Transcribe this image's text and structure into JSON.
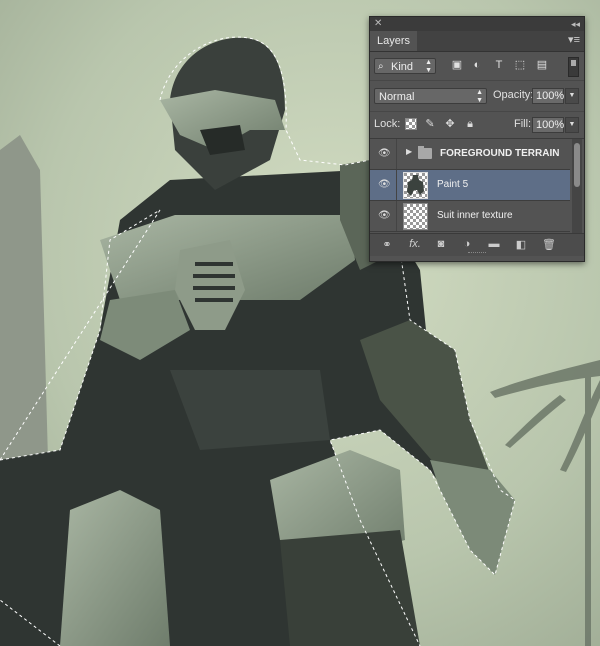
{
  "panel": {
    "close_glyph": "✕",
    "collapse_glyph": "◂◂",
    "tab_label": "Layers",
    "menu_glyph": "▾≡",
    "filter": {
      "kind_label": "Kind",
      "icons": [
        "image-filter-icon",
        "adjustment-filter-icon",
        "type-filter-icon",
        "shape-filter-icon",
        "smart-object-filter-icon"
      ]
    },
    "blend_mode": "Normal",
    "opacity_label": "Opacity:",
    "opacity_value": "100%",
    "lock_label": "Lock:",
    "fill_label": "Fill:",
    "fill_value": "100%",
    "layers": [
      {
        "name": "FOREGROUND TERRAIN",
        "type": "group",
        "visible": true,
        "selected": false
      },
      {
        "name": "Paint 5",
        "type": "layer",
        "visible": true,
        "selected": true
      },
      {
        "name": "Suit inner texture",
        "type": "layer",
        "visible": true,
        "selected": false
      }
    ],
    "bottom_icons": [
      "link-icon",
      "fx-icon",
      "mask-icon",
      "adjustment-icon",
      "new-group-icon",
      "new-layer-icon",
      "trash-icon"
    ],
    "fx_label": "fx."
  },
  "colors": {
    "panel_bg": "#535353",
    "selected_row": "#5e6e87",
    "sky": "#c4cfb5",
    "armor_light": "#8f9e8b",
    "armor_dark": "#2f3532"
  }
}
